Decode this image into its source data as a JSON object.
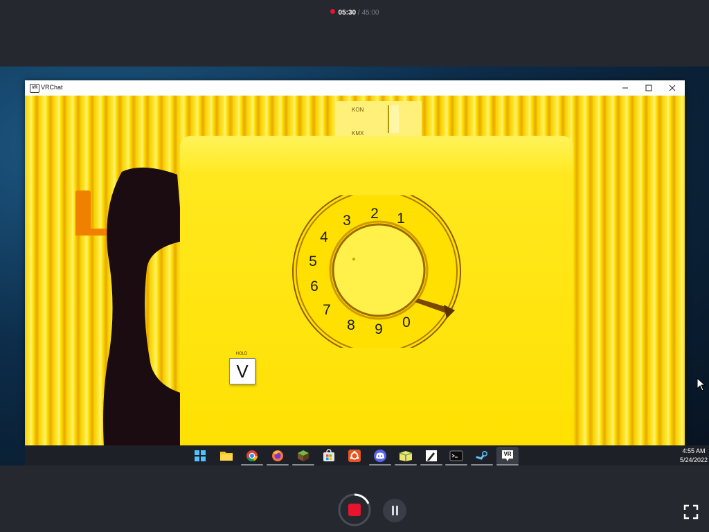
{
  "recorder": {
    "elapsed": "05:30",
    "separator": " / ",
    "total": "45:00",
    "colors": {
      "record": "#e8132d",
      "background": "#262830"
    }
  },
  "window": {
    "title": "VRChat",
    "app_icon_text": "VR",
    "controls": [
      "minimize-icon",
      "maximize-icon",
      "close-icon"
    ]
  },
  "scene": {
    "phone_tab_labels": [
      "KON",
      "KMX"
    ],
    "dial_numbers": [
      "1",
      "2",
      "3",
      "4",
      "5",
      "6",
      "7",
      "8",
      "9",
      "0"
    ],
    "hold_label": "HOLD",
    "hold_key": "V",
    "colors": {
      "curtain": "#f6cf00",
      "phone": "#ffe000",
      "hooks": "#f08000",
      "handset": "#1a0c10"
    }
  },
  "taskbar": {
    "icons": [
      "windows-start-icon",
      "file-explorer-icon",
      "chrome-icon",
      "firefox-icon",
      "minecraft-icon",
      "microsoft-store-icon",
      "ubuntu-icon",
      "discord-icon",
      "calibre-icon",
      "notepad-icon",
      "terminal-icon",
      "steam-icon",
      "vrchat-icon"
    ],
    "vr_icon_text": "VR",
    "clock_time": "4:55 AM",
    "clock_date": "5/24/2022"
  }
}
